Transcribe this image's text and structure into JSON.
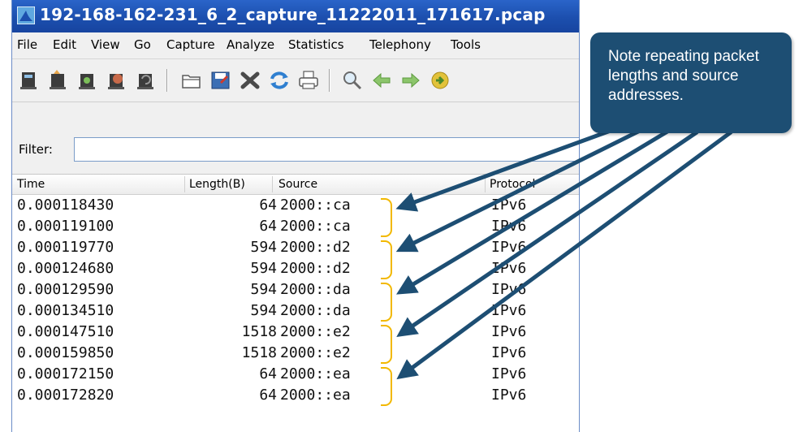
{
  "window": {
    "title": "192-168-162-231_6_2_capture_11222011_171617.pcap"
  },
  "menu": [
    "File",
    "Edit",
    "View",
    "Go",
    "Capture",
    "Analyze",
    "Statistics",
    "Telephony",
    "Tools"
  ],
  "toolbar": {
    "icons": [
      "interfaces-icon",
      "options-icon",
      "start-capture-icon",
      "stop-capture-icon",
      "restart-capture-icon",
      "open-file-icon",
      "save-file-icon",
      "close-file-icon",
      "reload-icon",
      "print-icon",
      "find-icon",
      "back-arrow-icon",
      "forward-arrow-icon",
      "go-to-packet-icon"
    ]
  },
  "filter": {
    "label": "Filter:",
    "value": ""
  },
  "packet_list": {
    "columns": [
      "Time",
      "Length(B)",
      "Source",
      "Protocol"
    ],
    "rows": [
      {
        "time": "0.000118430",
        "length": "64",
        "source": "2000::ca",
        "protocol": "IPv6"
      },
      {
        "time": "0.000119100",
        "length": "64",
        "source": "2000::ca",
        "protocol": "IPv6"
      },
      {
        "time": "0.000119770",
        "length": "594",
        "source": "2000::d2",
        "protocol": "IPv6"
      },
      {
        "time": "0.000124680",
        "length": "594",
        "source": "2000::d2",
        "protocol": "IPv6"
      },
      {
        "time": "0.000129590",
        "length": "594",
        "source": "2000::da",
        "protocol": "IPv6"
      },
      {
        "time": "0.000134510",
        "length": "594",
        "source": "2000::da",
        "protocol": "IPv6"
      },
      {
        "time": "0.000147510",
        "length": "1518",
        "source": "2000::e2",
        "protocol": "IPv6"
      },
      {
        "time": "0.000159850",
        "length": "1518",
        "source": "2000::e2",
        "protocol": "IPv6"
      },
      {
        "time": "0.000172150",
        "length": "64",
        "source": "2000::ea",
        "protocol": "IPv6"
      },
      {
        "time": "0.000172820",
        "length": "64",
        "source": "2000::ea",
        "protocol": "IPv6"
      }
    ]
  },
  "callout": {
    "text": "Note repeating packet lengths and source addresses."
  },
  "colors": {
    "titlebar": "#1c4fae",
    "callout": "#1d4e73",
    "arrow": "#1d4e73",
    "brace": "#f2b800"
  }
}
